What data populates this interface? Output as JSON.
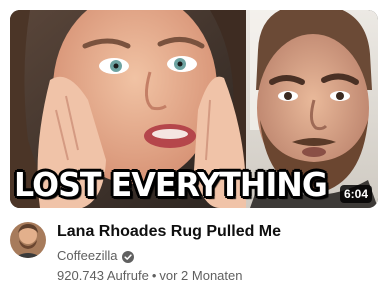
{
  "video": {
    "thumbnail_text": "LOST EVERYTHING",
    "duration": "6:04",
    "title": "Lana Rhoades Rug Pulled Me",
    "channel": "Coffeezilla",
    "views": "920.743 Aufrufe",
    "separator": "•",
    "age": "vor 2 Monaten"
  },
  "icons": {
    "verified": "verified-check-icon",
    "avatar": "channel-avatar"
  },
  "colors": {
    "title": "#0f0f0f",
    "meta": "#606060",
    "caption_fill": "#ffffff",
    "caption_outline": "#000000"
  }
}
